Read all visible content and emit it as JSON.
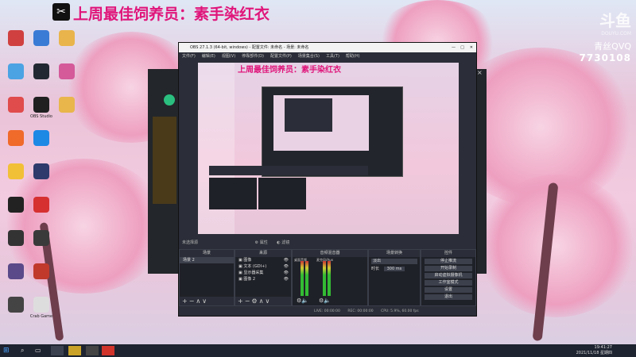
{
  "overlay": {
    "title": "上周最佳饲养员：素手染红衣",
    "logo_icon": "capcut-icon"
  },
  "watermark": {
    "brand": "斗鱼",
    "site": "DOUYU.COM",
    "group": "青丝QVQ",
    "room_id": "7730108"
  },
  "desktop_icons": [
    {
      "label": "",
      "color": "#d04040"
    },
    {
      "label": "",
      "color": "#3a7bd5"
    },
    {
      "label": "",
      "color": "#e9b44c"
    },
    {
      "label": "",
      "color": "#4ba3e3"
    },
    {
      "label": "",
      "color": "#222831"
    },
    {
      "label": "",
      "color": "#d45a9a"
    },
    {
      "label": "",
      "color": "#e04b4b"
    },
    {
      "label": "OBS Studio",
      "color": "#202020"
    },
    {
      "label": "",
      "color": "#e8b64b"
    },
    {
      "label": "",
      "color": "#f06a2a"
    },
    {
      "label": "",
      "color": "#1e88e5"
    },
    {
      "label": "",
      "color": "#f2c037"
    },
    {
      "label": "",
      "color": "#2d3a6b"
    },
    {
      "label": "",
      "color": "#222"
    },
    {
      "label": "",
      "color": "#d63031"
    },
    {
      "label": "",
      "color": "#333"
    },
    {
      "label": "",
      "color": "#3a3a3a"
    },
    {
      "label": "",
      "color": "#5a4a8a"
    },
    {
      "label": "",
      "color": "#c0392b"
    },
    {
      "label": "",
      "color": "#444"
    },
    {
      "label": "Crab Game",
      "color": "#ddd"
    }
  ],
  "obs": {
    "title": "OBS 27.1.3 (64-bit, windows) - 配置文件: 未命名 - 场景: 未命名",
    "menu": [
      "文件(F)",
      "编辑(E)",
      "视图(V)",
      "停靠部件(D)",
      "配置文件(P)",
      "场景集合(S)",
      "工具(T)",
      "帮助(H)"
    ],
    "scene_bar": {
      "label": "未选择源",
      "btn1": "属性",
      "btn2": "滤镜"
    },
    "docks": {
      "scenes": {
        "title": "场景",
        "items": [
          "场景 2"
        ]
      },
      "sources": {
        "title": "来源",
        "items": [
          "图像",
          "文本 (GDI+)",
          "显示器采集",
          "图像 2"
        ]
      },
      "mixer": {
        "title": "音频混音器",
        "ch1": "桌面音频",
        "ch2": "麦克风/Aux",
        "db1": "0.0 dB",
        "db2": "0.0 dB"
      },
      "transitions": {
        "title": "场景转换",
        "type": "淡出",
        "duration_label": "时长",
        "duration": "300 ms"
      },
      "controls": {
        "title": "控件",
        "buttons": [
          "停止推流",
          "开始录制",
          "启动虚拟摄像机",
          "工作室模式",
          "设置",
          "退出"
        ]
      }
    },
    "status": {
      "live": "LIVE: 00:00:00",
      "rec": "REC: 00:00:00",
      "cpu": "CPU: 5.9%, 60.00 fps"
    }
  },
  "taskbar": {
    "time": "19:41:27",
    "date": "2021/11/18 星期四"
  }
}
